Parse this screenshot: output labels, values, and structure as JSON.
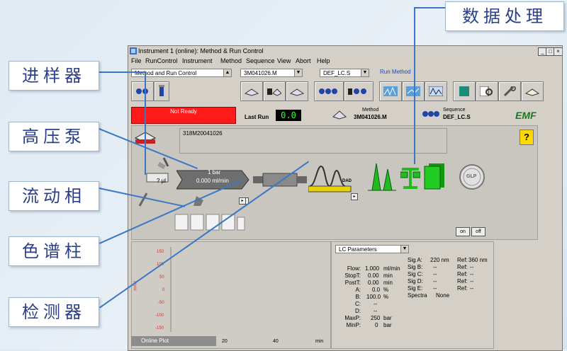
{
  "callouts": {
    "injector": "进样器",
    "pump": "高压泵",
    "mobile_phase": "流动相",
    "column": "色谱柱",
    "detector": "检测器",
    "data_processing": "数据处理"
  },
  "window": {
    "title": "Instrument 1 (online): Method & Run Control",
    "controls": [
      "_",
      "□",
      "×"
    ],
    "menu": [
      "File",
      "RunControl",
      "Instrument",
      "Method",
      "Sequence",
      "View",
      "Abort",
      "Help"
    ]
  },
  "toolbar": {
    "view_combo": "Method and Run Control",
    "method_combo": "3M041026.M",
    "sequence_combo": "DEF_LC.S",
    "run_method_label": "Run Method"
  },
  "status": {
    "state": "Not Ready",
    "last_run_label": "Last Run",
    "last_run_value": "0.0",
    "method_label": "Method",
    "method_value": "3M041026.M",
    "sequence_label": "Sequence",
    "sequence_value": "DEF_LC.S",
    "logo": "EMF",
    "help": "?",
    "sample_name": "318M20041026"
  },
  "modules": {
    "injector_value": "? µl",
    "pump_pressure": "1 bar",
    "pump_flow": "0.000 ml/min",
    "detector_tag": "DAD",
    "glp": "GLP",
    "on": "on",
    "off": "off"
  },
  "plot": {
    "y_ticks": [
      "150",
      "100",
      "50",
      "0",
      "-50",
      "-100",
      "-150"
    ],
    "x_ticks": [
      "20",
      "40",
      "min"
    ],
    "ylabel": "mAU",
    "tab_label": "Online Plot"
  },
  "lc_params": {
    "dropdown": "LC Parameters",
    "left": [
      {
        "k": "Flow:",
        "v": "1.000",
        "u": "ml/min"
      },
      {
        "k": "StopT:",
        "v": "0.00",
        "u": "min"
      },
      {
        "k": "PostT:",
        "v": "0.00",
        "u": "min"
      },
      {
        "k": "A:",
        "v": "0.0",
        "u": "%"
      },
      {
        "k": "B:",
        "v": "100.0",
        "u": "%"
      },
      {
        "k": "C:",
        "v": "--",
        "u": ""
      },
      {
        "k": "D:",
        "v": "--",
        "u": ""
      },
      {
        "k": "MaxP:",
        "v": "250",
        "u": "bar"
      },
      {
        "k": "MinP:",
        "v": "0",
        "u": "bar"
      }
    ],
    "sig": [
      {
        "k": "Sig A:",
        "v": "220 nm",
        "rk": "Ref:",
        "rv": "360 nm"
      },
      {
        "k": "Sig B:",
        "v": "--",
        "rk": "Ref:",
        "rv": "--"
      },
      {
        "k": "Sig C:",
        "v": "--",
        "rk": "Ref:",
        "rv": "--"
      },
      {
        "k": "Sig D:",
        "v": "--",
        "rk": "Ref:",
        "rv": "--"
      },
      {
        "k": "Sig E:",
        "v": "--",
        "rk": "Ref:",
        "rv": "--"
      }
    ],
    "spectra_label": "Spectra",
    "spectra_value": "None"
  },
  "colors": {
    "callout_text": "#2b3f87",
    "connector": "#3a78c6",
    "not_ready": "#ff1a1a",
    "last_run_bg": "#000000",
    "last_run_fg": "#33ff33",
    "green": "#22bb22"
  }
}
